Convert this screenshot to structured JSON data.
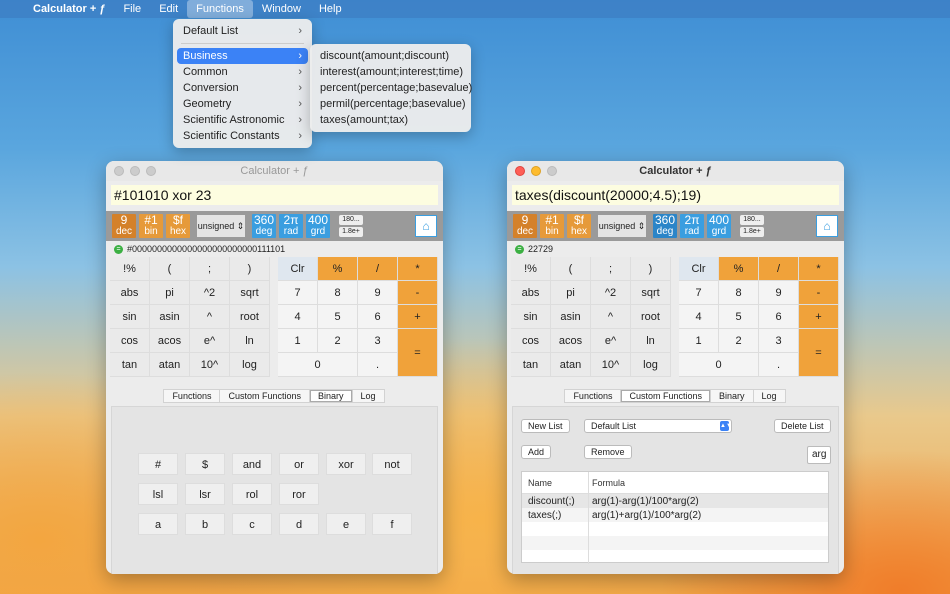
{
  "menubar": {
    "app": "Calculator + ƒ",
    "items": [
      "File",
      "Edit",
      "Functions",
      "Window",
      "Help"
    ]
  },
  "functions_menu": {
    "items": [
      {
        "label": "Default List",
        "chevron": "›"
      },
      {
        "label": "Business",
        "chevron": "›"
      },
      {
        "label": "Common",
        "chevron": "›"
      },
      {
        "label": "Conversion",
        "chevron": "›"
      },
      {
        "label": "Geometry",
        "chevron": "›"
      },
      {
        "label": "Scientific Astronomic",
        "chevron": "›"
      },
      {
        "label": "Scientific Constants",
        "chevron": "›"
      }
    ]
  },
  "business_menu": {
    "items": [
      "discount(amount;discount)",
      "interest(amount;interest;time)",
      "percent(percentage;basevalue)",
      "permil(percentage;basevalue)",
      "taxes(amount;tax)"
    ]
  },
  "win_left": {
    "title": "Calculator + ƒ",
    "expression": "#101010 xor 23",
    "result": "#0000000000000000000000000111101"
  },
  "win_right": {
    "title": "Calculator + ƒ",
    "expression": "taxes(discount(20000;4.5);19)",
    "result": "22729"
  },
  "modes": {
    "dec": [
      "9",
      "dec"
    ],
    "bin": [
      "#1",
      "bin"
    ],
    "hex": [
      "$f",
      "hex"
    ],
    "unsigned": "unsigned",
    "deg": [
      "360",
      "deg"
    ],
    "rad": [
      "2π",
      "rad"
    ],
    "grd": [
      "400",
      "grd"
    ],
    "prec1": "180...",
    "prec2": "1.8e+",
    "home_icon": "home-icon"
  },
  "keys": {
    "left": [
      "!%",
      "(",
      ";",
      ")",
      "abs",
      "pi",
      "^2",
      "sqrt",
      "sin",
      "asin",
      "^",
      "root",
      "cos",
      "acos",
      "e^",
      "ln",
      "tan",
      "atan",
      "10^",
      "log"
    ],
    "right": [
      "Clr",
      "%",
      "/",
      "*",
      "7",
      "8",
      "9",
      "-",
      "4",
      "5",
      "6",
      "+",
      "1",
      "2",
      "3",
      "=",
      "0",
      ".",
      ""
    ]
  },
  "tabs": [
    "Functions",
    "Custom Functions",
    "Binary",
    "Log"
  ],
  "binary_keys": [
    "#",
    "$",
    "and",
    "or",
    "xor",
    "not",
    "lsl",
    "lsr",
    "rol",
    "ror",
    "a",
    "b",
    "c",
    "d",
    "e",
    "f"
  ],
  "custom": {
    "new_list": "New List",
    "list_value": "Default List",
    "delete_list": "Delete List",
    "add": "Add",
    "remove": "Remove",
    "arg": "arg",
    "col_name": "Name",
    "col_formula": "Formula",
    "rows": [
      {
        "name": "discount(;)",
        "formula": "arg(1)-arg(1)/100*arg(2)"
      },
      {
        "name": "taxes(;)",
        "formula": "arg(1)+arg(1)/100*arg(2)"
      }
    ]
  },
  "colors": {
    "orange": "#f0a23a",
    "blue": "#3a9ee0",
    "highlight": "#3b82f6"
  }
}
